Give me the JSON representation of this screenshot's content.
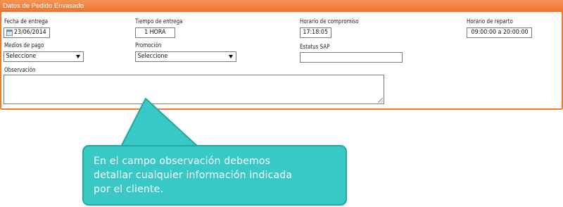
{
  "panel": {
    "title": "Datos de Pedido Envasado"
  },
  "fields": {
    "fecha_entrega": {
      "label": "Fecha de entrega",
      "value": "23/06/2014",
      "icon": "calendar-icon"
    },
    "tiempo_entrega": {
      "label": "Tiempo de entrega",
      "value": "1 HORA"
    },
    "horario_compromiso": {
      "label": "Horario de compromiso",
      "value": "17:18:05"
    },
    "horario_reparto": {
      "label": "Horario de reparto",
      "value": "09:00:00 a 20:00:00"
    },
    "medios_pago": {
      "label": "Medios de pago",
      "selected": "Seleccione"
    },
    "promocion": {
      "label": "Promoción",
      "selected": "Seleccione"
    },
    "estatus_sap": {
      "label": "Estatus SAP",
      "value": ""
    },
    "observacion": {
      "label": "Observación",
      "value": ""
    }
  },
  "callout": {
    "lines": [
      "En el campo observación debemos",
      "detallar cualquier información indicada",
      "por el cliente."
    ]
  },
  "colors": {
    "header": "#ef7330",
    "panel_border": "#f07a2c",
    "callout_fill": "#38c9c7",
    "callout_border": "#1fa8a4"
  }
}
